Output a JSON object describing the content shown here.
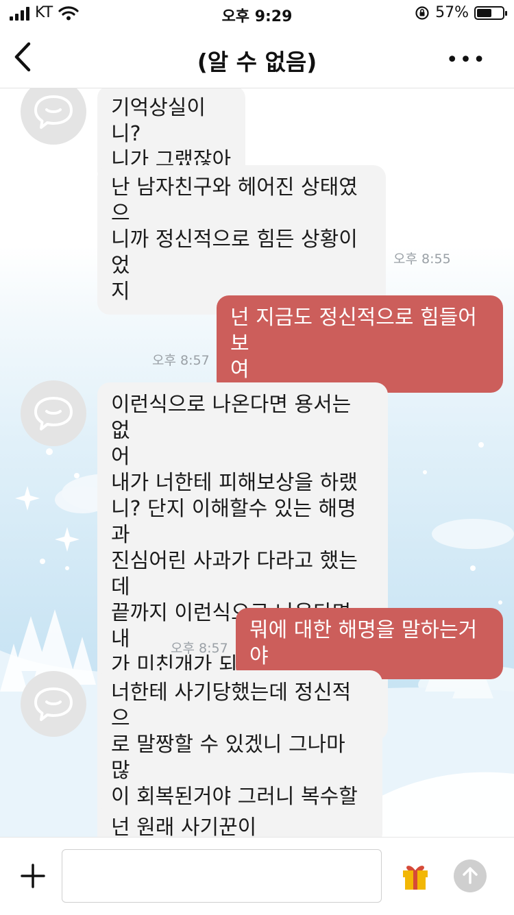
{
  "status_bar": {
    "carrier": "KT",
    "time": "오후 9:29",
    "battery_percent": "57%",
    "battery_level": 0.57
  },
  "header": {
    "title": "(알 수 없음)",
    "back_icon": "chevron-left-icon",
    "more_icon": "more-horizontal-icon"
  },
  "messages": [
    {
      "side": "in",
      "avatar": true,
      "text": "기억상실이니?\n니가 그랬잖아",
      "time": ""
    },
    {
      "side": "in",
      "avatar": false,
      "text": "난 남자친구와 헤어진 상태였으\n니까 정신적으로 힘든 상황이었\n지",
      "time": "오후 8:55"
    },
    {
      "side": "out",
      "text": "넌 지금도 정신적으로 힘들어보\n여",
      "time": "오후 8:57"
    },
    {
      "side": "in",
      "avatar": true,
      "text": "이런식으로 나온다면 용서는 없\n어\n내가 너한테 피해보상을 하랬\n니? 단지 이해할수 있는 해명과\n진심어린 사과가 다라고 했는데\n끝까지 이런식으로 나온다면 내\n가 미친개가 되는걸 보겠다는거\n지",
      "time": ""
    },
    {
      "side": "out",
      "text": "뭐에 대한 해명을 말하는거야",
      "time": "오후 8:57"
    },
    {
      "side": "in",
      "avatar": true,
      "text": "너한테 사기당했는데 정신적으\n로 말짱할 수 있겠니 그나마 많\n이 회복된거야 그러니 복수할\n생각을 하는거지",
      "time": ""
    },
    {
      "side": "in",
      "avatar": false,
      "text": "넌 원래 사기꾼이니?",
      "time": ""
    }
  ],
  "input_bar": {
    "placeholder": "",
    "plus_icon": "plus-icon",
    "gift_icon": "gift-icon",
    "send_icon": "send-arrow-icon"
  },
  "colors": {
    "outgoing_bubble": "#cc5e5b",
    "incoming_bubble": "#f3f3f3",
    "background": "#c0dff1"
  }
}
